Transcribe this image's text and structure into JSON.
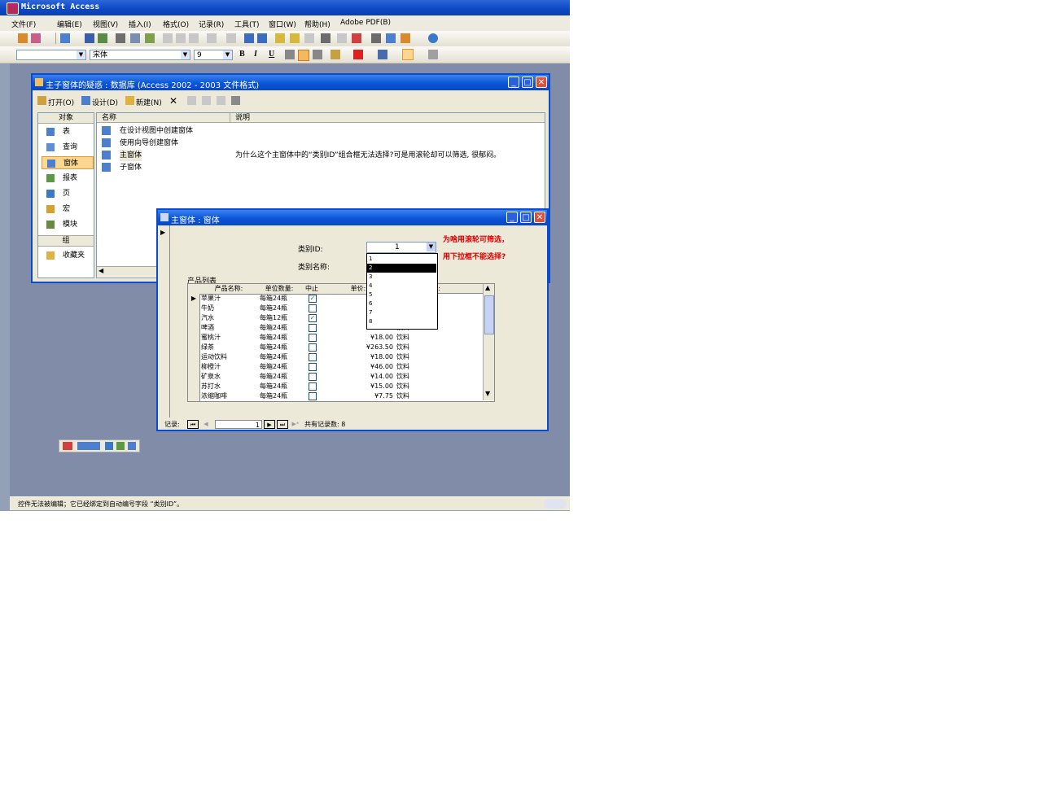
{
  "app": {
    "title": "Microsoft Access",
    "status": "控件无法被编辑；它已经绑定到自动编号字段 “类别ID”。"
  },
  "menubar": {
    "items": [
      "文件(F)",
      "编辑(E)",
      "视图(V)",
      "插入(I)",
      "格式(O)",
      "记录(R)",
      "工具(T)",
      "窗口(W)",
      "帮助(H)",
      "Adobe PDF(B)"
    ]
  },
  "format_toolbar": {
    "object_combo": "",
    "font": "宋体",
    "size": "9",
    "bold": "B",
    "italic": "I",
    "underline": "U"
  },
  "db_window": {
    "title": "主子窗体的疑惑 : 数据库 (Access 2002 - 2003 文件格式)",
    "toolbar": {
      "open": "打开(O)",
      "design": "设计(D)",
      "new": "新建(N)"
    },
    "objects_header": "对象",
    "objects": [
      "表",
      "查询",
      "窗体",
      "报表",
      "页",
      "宏",
      "模块"
    ],
    "selected_object": "窗体",
    "groups_header": "组",
    "groups": [
      "收藏夹"
    ],
    "columns": {
      "name": "名称",
      "desc": "说明"
    },
    "items": [
      {
        "name": "在设计视图中创建窗体",
        "desc": ""
      },
      {
        "name": "使用向导创建窗体",
        "desc": ""
      },
      {
        "name": "主窗体",
        "desc": "为什么这个主窗体中的“类别ID”组合框无法选择?可是用滚轮却可以筛选, 很郁闷。"
      },
      {
        "name": "子窗体",
        "desc": ""
      }
    ]
  },
  "form": {
    "title": "主窗体 : 窗体",
    "category_id_label": "类别ID:",
    "category_id_value": "1",
    "category_name_label": "类别名称:",
    "note1": "为啥用滚轮可筛选，",
    "note2": "用下拉框不能选择?",
    "subform_label": "产品列表",
    "grid_headers": [
      "产品名称:",
      "单位数量:",
      "中止",
      "单价:",
      "类别:"
    ],
    "rows": [
      {
        "name": "苹果汁",
        "unit": "每箱24瓶",
        "disc": true,
        "price": "",
        "cat": ""
      },
      {
        "name": "牛奶",
        "unit": "每箱24瓶",
        "disc": false,
        "price": "",
        "cat": ""
      },
      {
        "name": "汽水",
        "unit": "每箱12瓶",
        "disc": true,
        "price": "",
        "cat": ""
      },
      {
        "name": "啤酒",
        "unit": "每箱24瓶",
        "disc": false,
        "price": "¥14.00",
        "cat": "饮料"
      },
      {
        "name": "蜜桃汁",
        "unit": "每箱24瓶",
        "disc": false,
        "price": "¥18.00",
        "cat": "饮料"
      },
      {
        "name": "绿茶",
        "unit": "每箱24瓶",
        "disc": false,
        "price": "¥263.50",
        "cat": "饮料"
      },
      {
        "name": "运动饮料",
        "unit": "每箱24瓶",
        "disc": false,
        "price": "¥18.00",
        "cat": "饮料"
      },
      {
        "name": "柳橙汁",
        "unit": "每箱24瓶",
        "disc": false,
        "price": "¥46.00",
        "cat": "饮料"
      },
      {
        "name": "矿泉水",
        "unit": "每箱24瓶",
        "disc": false,
        "price": "¥14.00",
        "cat": "饮料"
      },
      {
        "name": "苏打水",
        "unit": "每箱24瓶",
        "disc": false,
        "price": "¥15.00",
        "cat": "饮料"
      },
      {
        "name": "浓缩咖啡",
        "unit": "每箱24瓶",
        "disc": false,
        "price": "¥7.75",
        "cat": "饮料"
      }
    ],
    "dropdown_options": [
      "1",
      "2",
      "3",
      "4",
      "5",
      "6",
      "7",
      "8"
    ],
    "dropdown_selected": "2",
    "nav": {
      "label": "记录:",
      "current": "1",
      "total_text": "共有记录数: 8"
    }
  },
  "colors": {
    "title_blue": "#0a55d8",
    "mdi_bg": "#808ca8",
    "note_red": "#e00000",
    "selection": "#000000"
  }
}
